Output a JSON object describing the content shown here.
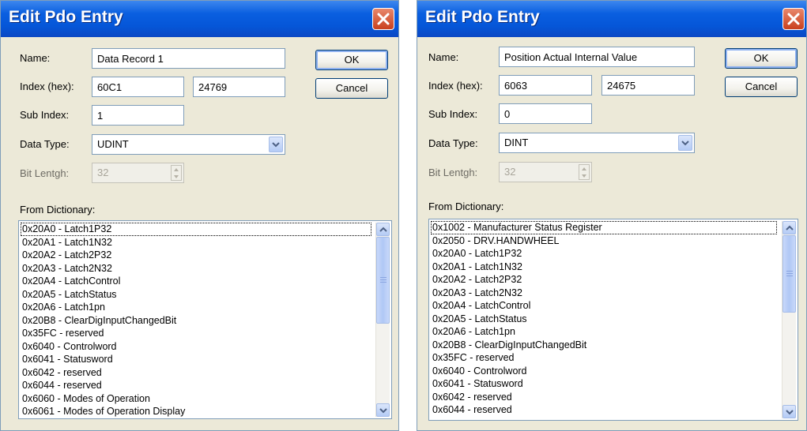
{
  "dialogs": [
    {
      "title": "Edit Pdo Entry",
      "name_label": "Name:",
      "name_value": "Data Record 1",
      "index_label": "Index (hex):",
      "index_value": "60C1",
      "index_decimal": "24769",
      "subindex_label": "Sub Index:",
      "subindex_value": "1",
      "datatype_label": "Data Type:",
      "datatype_value": "UDINT",
      "bitlength_label": "Bit Lentgh:",
      "bitlength_value": "32",
      "dictionary_label": "From Dictionary:",
      "ok_label": "OK",
      "cancel_label": "Cancel",
      "dictionary_items": [
        "0x20A0 - Latch1P32",
        "0x20A1 - Latch1N32",
        "0x20A2 - Latch2P32",
        "0x20A3 - Latch2N32",
        "0x20A4 - LatchControl",
        "0x20A5 - LatchStatus",
        "0x20A6 - Latch1pn",
        "0x20B8 - ClearDigInputChangedBit",
        "0x35FC - reserved",
        "0x6040 - Controlword",
        "0x6041 - Statusword",
        "0x6042 - reserved",
        "0x6044 - reserved",
        "0x6060 - Modes of Operation",
        "0x6061 - Modes of Operation Display"
      ]
    },
    {
      "title": "Edit Pdo Entry",
      "name_label": "Name:",
      "name_value": "Position Actual Internal Value",
      "index_label": "Index (hex):",
      "index_value": "6063",
      "index_decimal": "24675",
      "subindex_label": "Sub Index:",
      "subindex_value": "0",
      "datatype_label": "Data Type:",
      "datatype_value": "DINT",
      "bitlength_label": "Bit Lentgh:",
      "bitlength_value": "32",
      "dictionary_label": "From Dictionary:",
      "ok_label": "OK",
      "cancel_label": "Cancel",
      "dictionary_items": [
        "0x1002 - Manufacturer Status Register",
        "0x2050 - DRV.HANDWHEEL",
        "0x20A0 - Latch1P32",
        "0x20A1 - Latch1N32",
        "0x20A2 - Latch2P32",
        "0x20A3 - Latch2N32",
        "0x20A4 - LatchControl",
        "0x20A5 - LatchStatus",
        "0x20A6 - Latch1pn",
        "0x20B8 - ClearDigInputChangedBit",
        "0x35FC - reserved",
        "0x6040 - Controlword",
        "0x6041 - Statusword",
        "0x6042 - reserved",
        "0x6044 - reserved"
      ]
    }
  ],
  "icons": {
    "close": "close-icon",
    "dropdown": "chevron-down-icon",
    "spin_up": "spin-up-icon",
    "spin_down": "spin-down-icon",
    "scroll_up": "scroll-up-arrow-icon",
    "scroll_down": "scroll-down-arrow-icon"
  },
  "colors": {
    "titlebar": "#0556d8",
    "dialog_bg": "#ece9d8",
    "close_button": "#d2542f",
    "field_border": "#7f9db9"
  }
}
